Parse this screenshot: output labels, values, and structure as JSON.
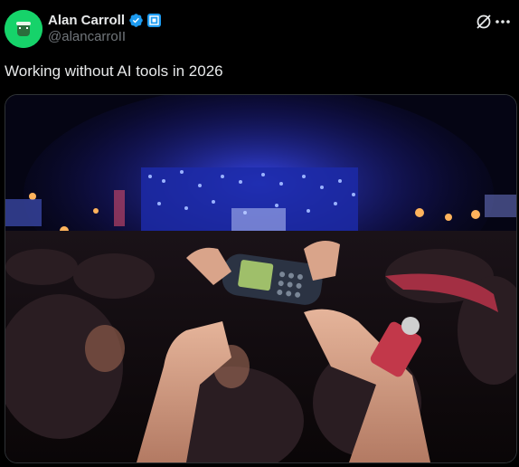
{
  "author": {
    "display_name": "Alan Carroll",
    "handle": "@alancarroII"
  },
  "tweet": {
    "text": "Working without AI tools in 2026"
  },
  "media": {
    "alt": ""
  },
  "icons": {
    "verified": "verified-badge-icon",
    "affiliation": "affiliation-badge-icon",
    "grok": "grok-icon",
    "more": "more-icon"
  },
  "colors": {
    "background": "#000000",
    "avatar": "#16d36a",
    "verified": "#1d9bf0",
    "text_primary": "#e7e9ea",
    "text_secondary": "#71767b"
  }
}
